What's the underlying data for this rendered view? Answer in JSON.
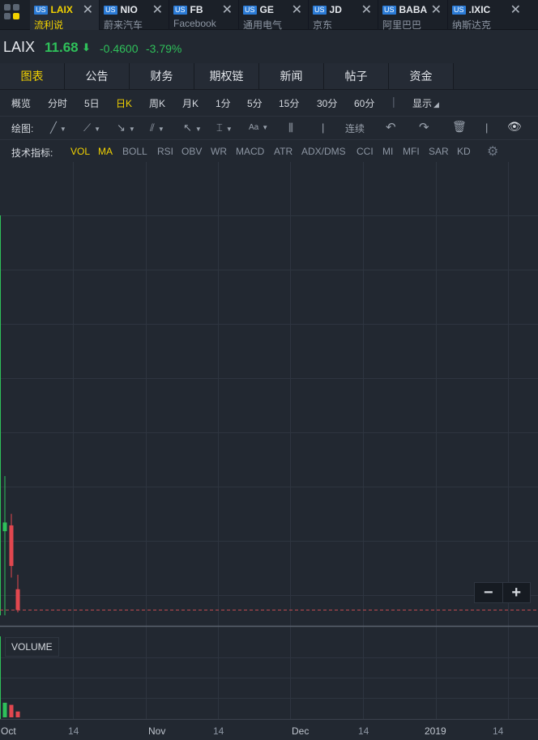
{
  "tabs": [
    {
      "market": "US",
      "symbol": "LAIX",
      "name": "流利说",
      "active": true
    },
    {
      "market": "US",
      "symbol": "NIO",
      "name": "蔚来汽车"
    },
    {
      "market": "US",
      "symbol": "FB",
      "name": "Facebook"
    },
    {
      "market": "US",
      "symbol": "GE",
      "name": "通用电气"
    },
    {
      "market": "US",
      "symbol": "JD",
      "name": "京东"
    },
    {
      "market": "US",
      "symbol": "BABA",
      "name": "阿里巴巴"
    },
    {
      "market": "US",
      "symbol": ".IXIC",
      "name": "纳斯达克"
    }
  ],
  "close_glyph": "✕",
  "quote": {
    "ticker": "LAIX",
    "price": "11.68",
    "arrow": "⬇",
    "change": "-0.4600",
    "change_pct": "-3.79%"
  },
  "main_tabs": [
    "图表",
    "公告",
    "财务",
    "期权链",
    "新闻",
    "帖子",
    "资金"
  ],
  "periods": [
    "概览",
    "分时",
    "5日",
    "日K",
    "周K",
    "月K",
    "1分",
    "5分",
    "15分",
    "30分",
    "60分"
  ],
  "period_active": "日K",
  "display_label": "显示",
  "draw": {
    "label": "绘图:",
    "continuous": "连续"
  },
  "indicators": {
    "label": "技术指标:",
    "items": [
      "VOL",
      "MA",
      "BOLL",
      "RSI",
      "OBV",
      "WR",
      "MACD",
      "ATR",
      "ADX/DMS",
      "CCI",
      "MI",
      "MFI",
      "SAR",
      "KD"
    ],
    "active": [
      "VOL",
      "MA"
    ]
  },
  "zoom": {
    "minus": "−",
    "plus": "+"
  },
  "volume_label": "VOLUME",
  "x_axis": [
    "Oct",
    "14",
    "Nov",
    "14",
    "Dec",
    "14",
    "2019",
    "14"
  ],
  "colors": {
    "up": "#2fc05a",
    "down": "#e2474f",
    "accent": "#f2d200",
    "bg": "#222831"
  },
  "chart_data": {
    "type": "candlestick",
    "x": [
      "Oct 1",
      "Oct 2",
      "Oct 3"
    ],
    "series": [
      {
        "open": 14.4,
        "high": 16.3,
        "low": 11.5,
        "close": 14.7
      },
      {
        "open": 14.6,
        "high": 15.0,
        "low": 12.8,
        "close": 13.2
      },
      {
        "open": 12.4,
        "high": 12.9,
        "low": 11.6,
        "close": 11.68
      }
    ],
    "last_close": 11.68,
    "volume": [
      3.5,
      3.0,
      1.4
    ]
  }
}
